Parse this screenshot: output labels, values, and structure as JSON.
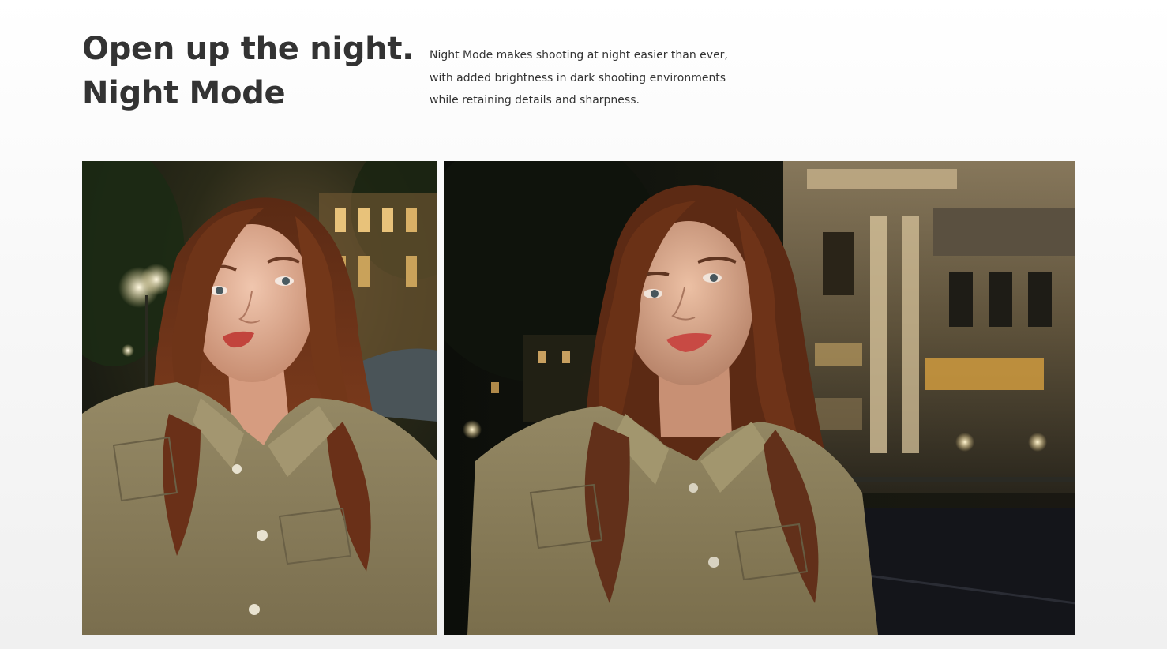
{
  "section": {
    "headline_line1": "Open up the night.",
    "headline_line2": "Night Mode",
    "description_line1": "Night Mode makes shooting at night easier than ever,",
    "description_line2": "with added brightness in dark shooting environments",
    "description_line3": "while retaining details and sharpness."
  },
  "photos": [
    {
      "name": "left-photo"
    },
    {
      "name": "right-photo"
    }
  ],
  "colors": {
    "text": "#333333",
    "shirt": "#8f8462",
    "hair": "#6b3218",
    "night_sky": "#0d0f0b"
  }
}
